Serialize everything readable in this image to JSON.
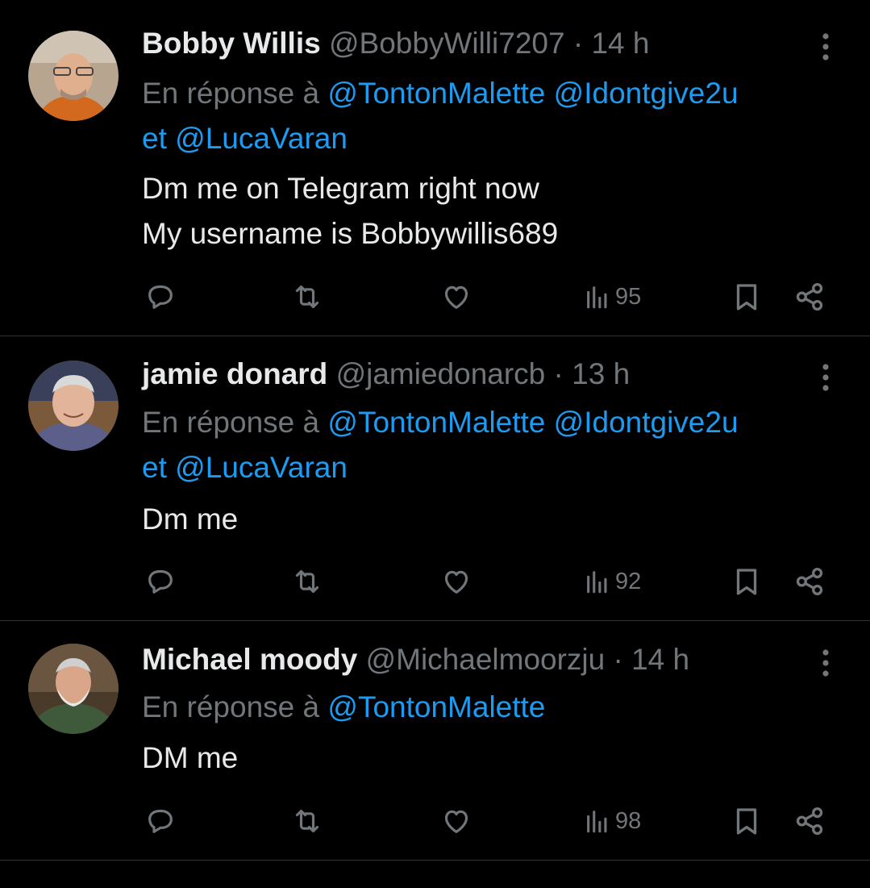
{
  "colors": {
    "background": "#000000",
    "text": "#e7e9ea",
    "secondary": "#71767b",
    "mention": "#1d9bf0",
    "separator": "#2f3336"
  },
  "tweets": [
    {
      "name": "Bobby Willis",
      "handle": "@BobbyWilli7207",
      "dot": "·",
      "time": "14 h",
      "reply_prefix": "En réponse à",
      "mentions": [
        "@TontonMalette",
        "@Idontgive2u"
      ],
      "and_word": "et",
      "last_mention": "@LucaVaran",
      "body_lines": [
        "Dm me on Telegram right now",
        "My username is Bobbywillis689"
      ],
      "views": "95",
      "icons": [
        "reply-icon",
        "retweet-icon",
        "like-icon",
        "views-icon",
        "bookmark-icon",
        "share-icon",
        "more-icon"
      ]
    },
    {
      "name": "jamie donard",
      "handle": "@jamiedonarcb",
      "dot": "·",
      "time": "13 h",
      "reply_prefix": "En réponse à",
      "mentions": [
        "@TontonMalette",
        "@Idontgive2u"
      ],
      "and_word": "et",
      "last_mention": "@LucaVaran",
      "body_lines": [
        "Dm me"
      ],
      "views": "92"
    },
    {
      "name": "Michael moody",
      "handle": "@Michaelmoorzju",
      "dot": "·",
      "time": "14 h",
      "reply_prefix": "En réponse à",
      "mentions": [
        "@TontonMalette"
      ],
      "body_lines": [
        "DM me"
      ],
      "views": "98"
    }
  ]
}
